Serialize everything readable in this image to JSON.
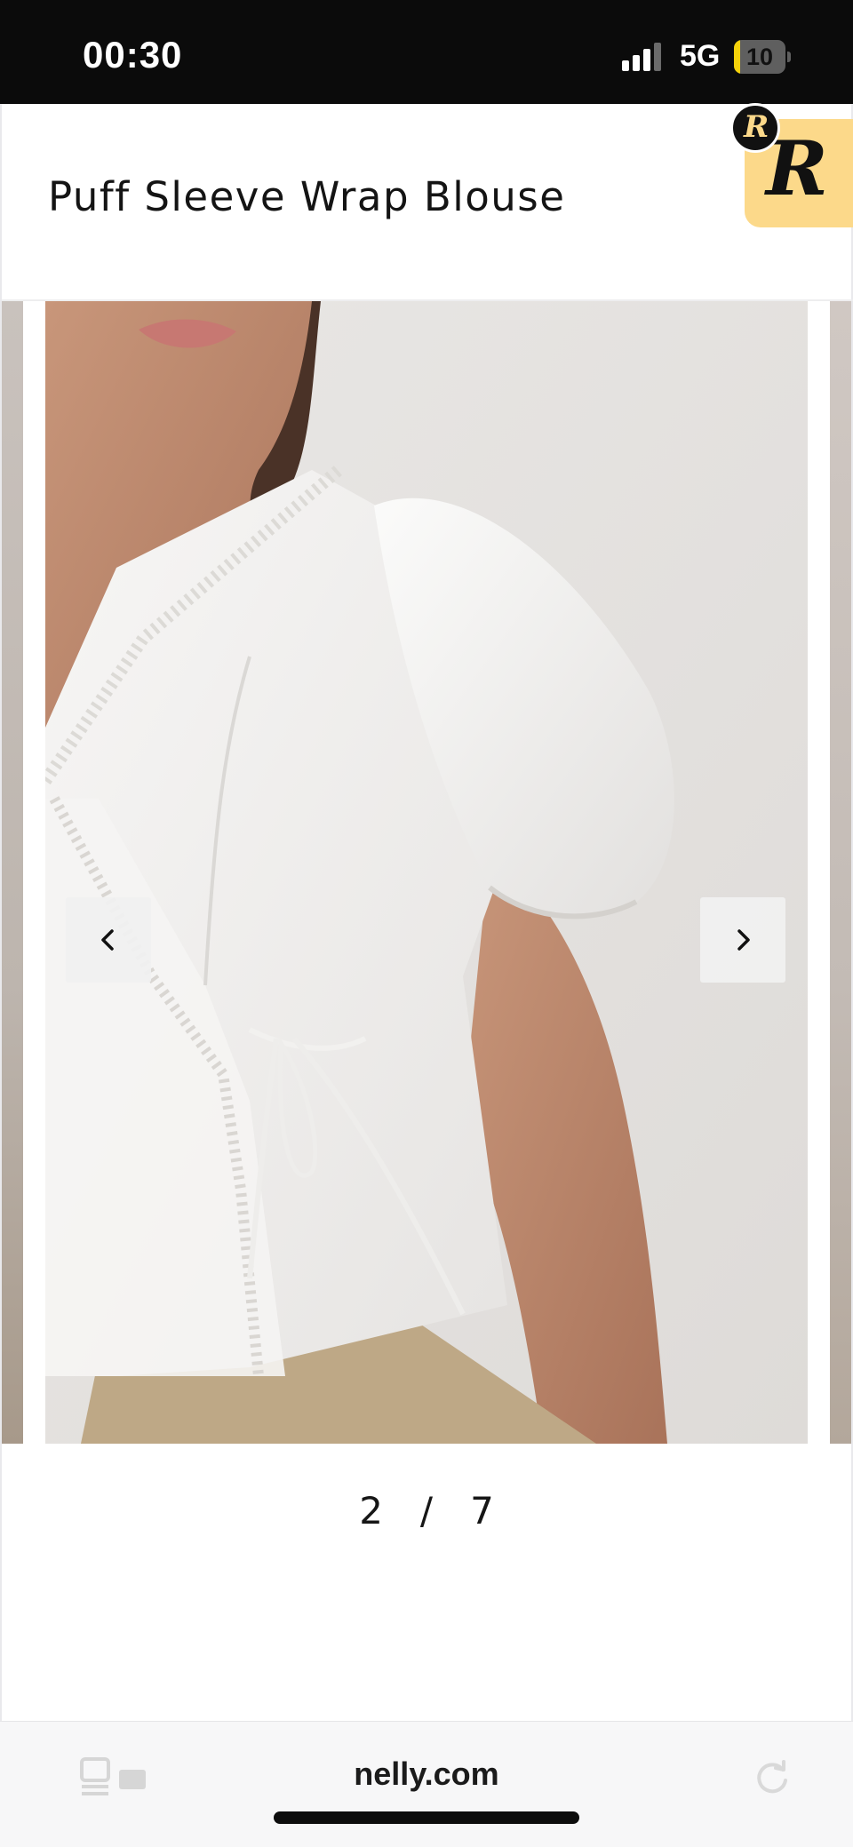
{
  "status_bar": {
    "time": "00:30",
    "network": "5G",
    "battery_level": "10",
    "battery_fraction": 0.1,
    "signal_bars_active": 3
  },
  "product": {
    "title": "Puff Sleeve Wrap Blouse"
  },
  "badge": {
    "letter": "R",
    "color": "#fcd98a"
  },
  "carousel": {
    "current": "2",
    "separator": "/",
    "total": "7",
    "prev_icon": "chevron-left-icon",
    "next_icon": "chevron-right-icon"
  },
  "browser": {
    "url": "nelly.com",
    "tabs_icon": "tabs-icon",
    "reload_icon": "reload-icon"
  }
}
